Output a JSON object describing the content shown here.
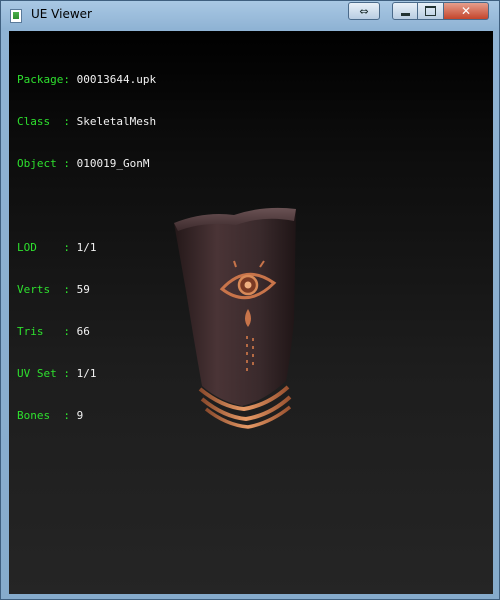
{
  "window": {
    "title": "UE Viewer"
  },
  "title_controls": {
    "resize_icon": "double-arrow-icon",
    "minimize_icon": "minimize-icon",
    "maximize_icon": "maximize-icon",
    "close_icon": "close-icon",
    "close_glyph": "✕",
    "resize_glyph": "⇔"
  },
  "info": {
    "package_label": "Package:",
    "package_value": "00013644.upk",
    "class_label": "Class  :",
    "class_value": "SkeletalMesh",
    "object_label": "Object :",
    "object_value": "010019_GonM",
    "lod_label": "LOD    :",
    "lod_value": "1/1",
    "verts_label": "Verts  :",
    "verts_value": "59",
    "tris_label": "Tris   :",
    "tris_value": "66",
    "uvset_label": "UV Set :",
    "uvset_value": "1/1",
    "bones_label": "Bones  :",
    "bones_value": "9"
  },
  "colors": {
    "label": "#2ee02e",
    "value": "#f2f2f2",
    "mesh_body": "#3a2a2c",
    "mesh_trim": "#c8744a"
  }
}
